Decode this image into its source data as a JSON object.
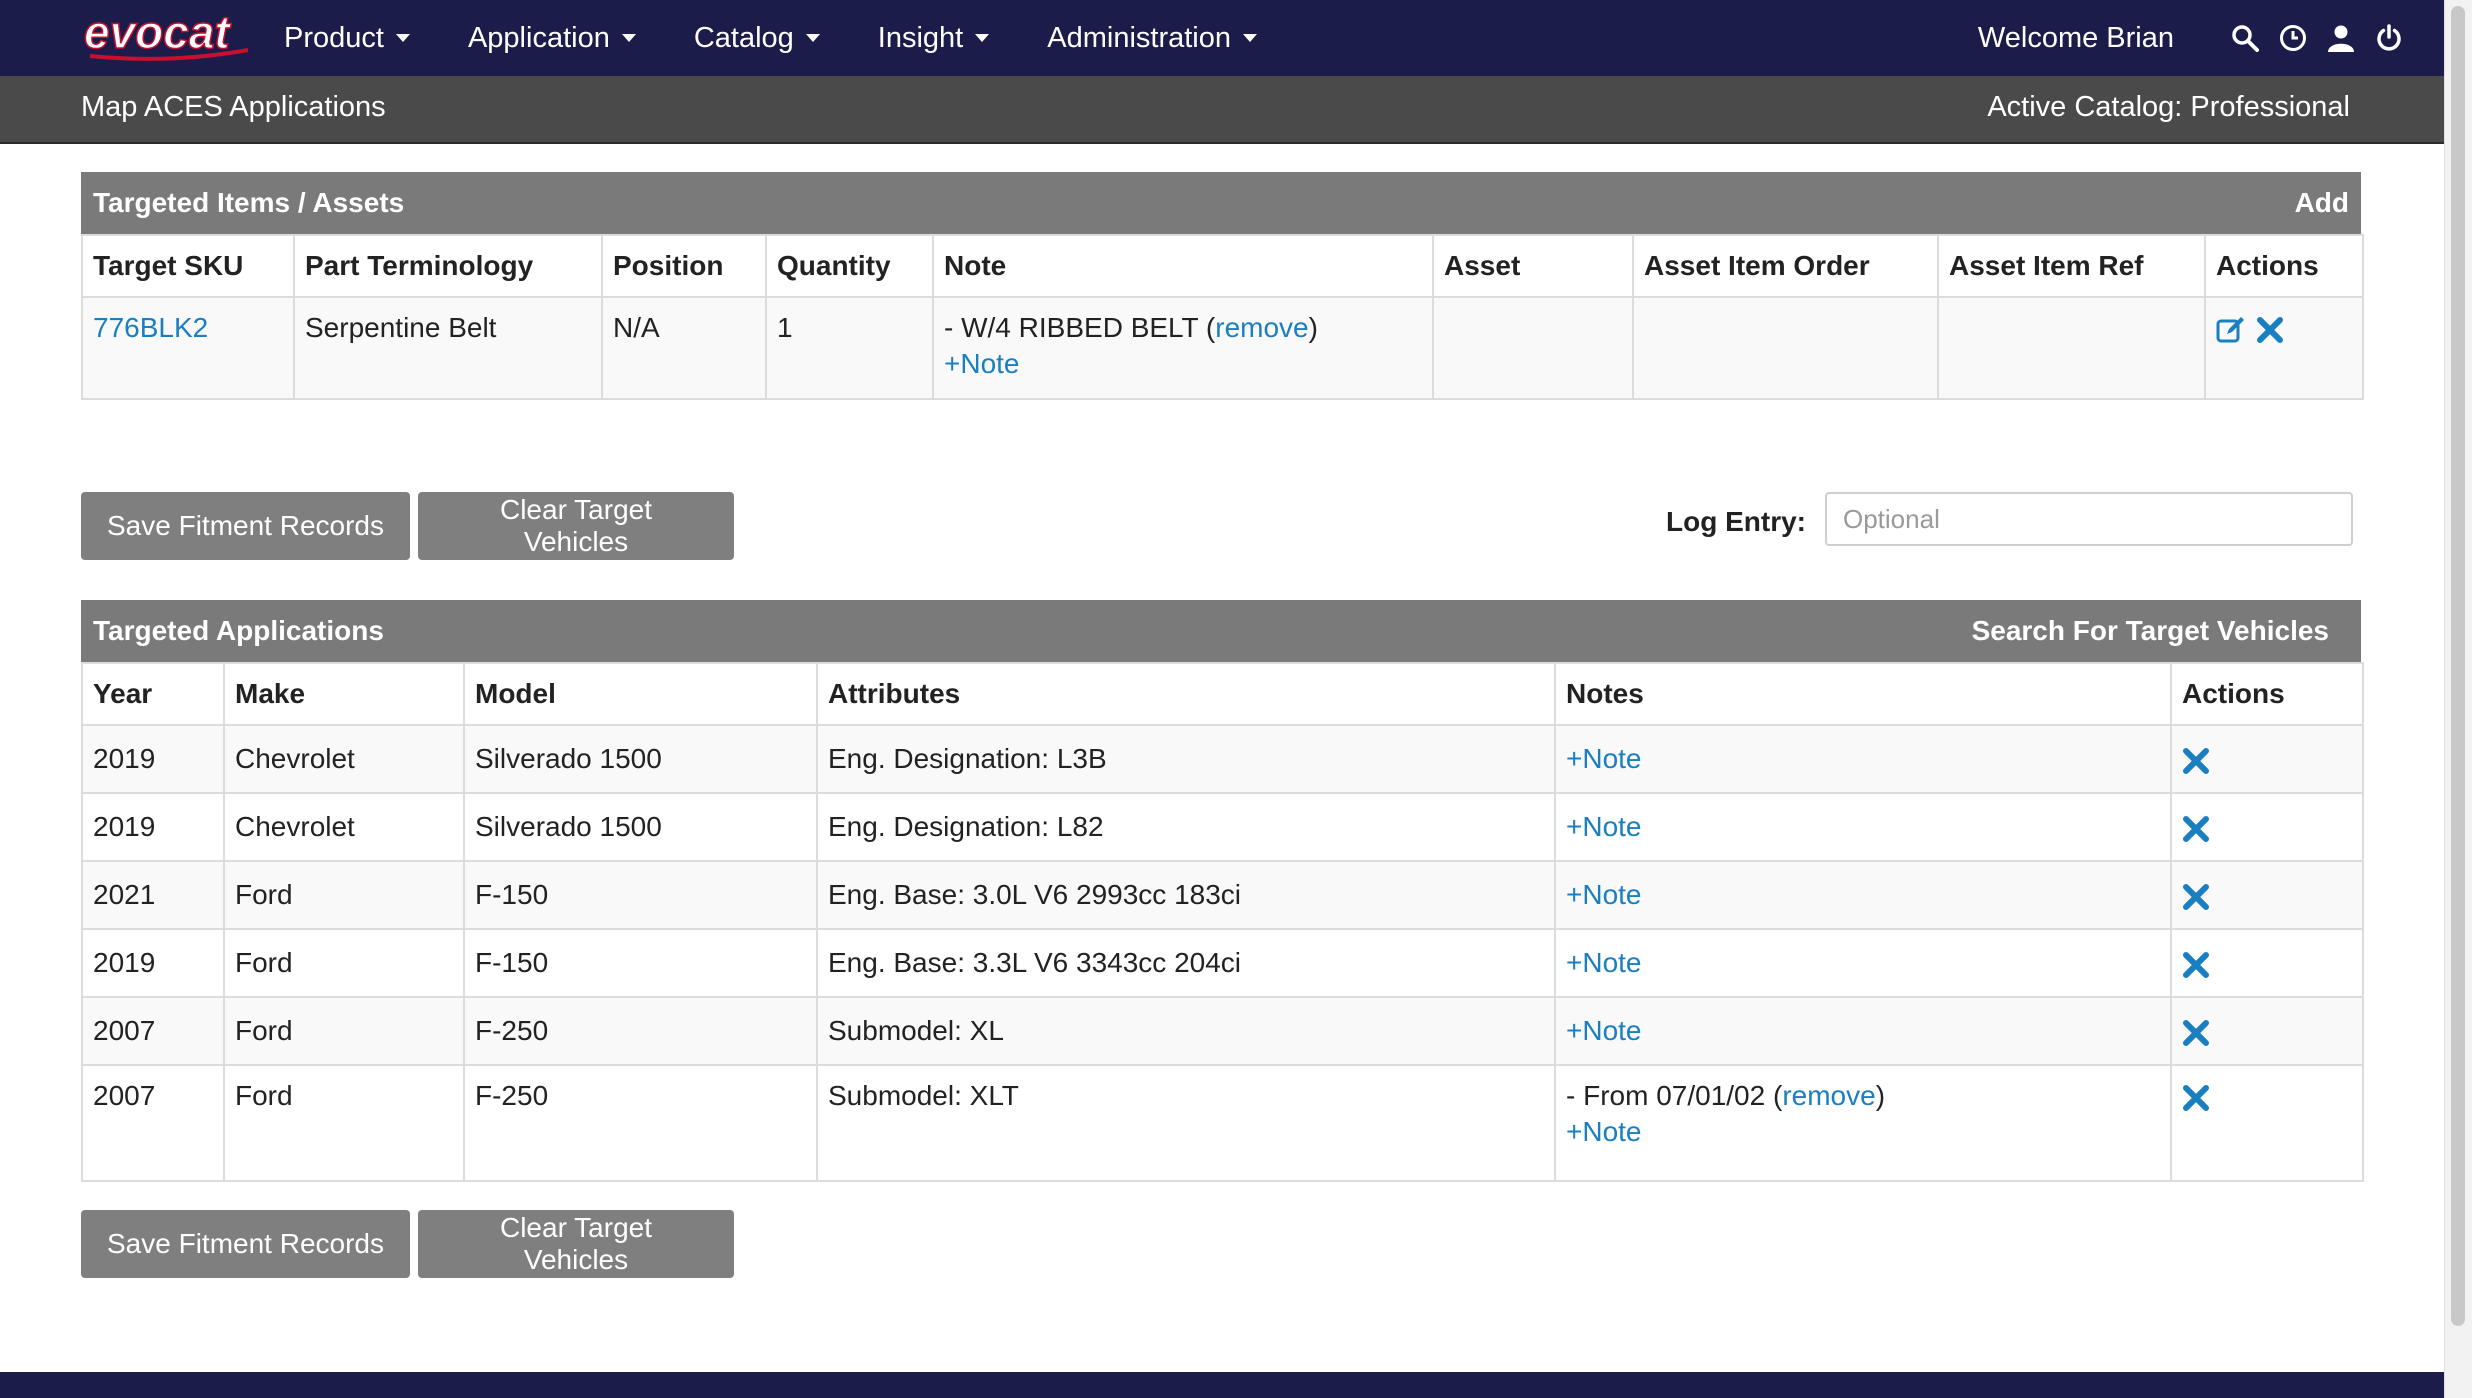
{
  "app": {
    "logo_text": "evocat"
  },
  "nav": {
    "items": [
      {
        "label": "Product"
      },
      {
        "label": "Application"
      },
      {
        "label": "Catalog"
      },
      {
        "label": "Insight"
      },
      {
        "label": "Administration"
      }
    ],
    "welcome": "Welcome Brian",
    "icons": [
      "search-icon",
      "history-icon",
      "user-icon",
      "power-icon"
    ]
  },
  "subheader": {
    "title": "Map ACES Applications",
    "active_catalog": "Active Catalog: Professional"
  },
  "items_panel": {
    "title": "Targeted Items / Assets",
    "action": "Add",
    "columns": [
      "Target SKU",
      "Part Terminology",
      "Position",
      "Quantity",
      "Note",
      "Asset",
      "Asset Item Order",
      "Asset Item Ref",
      "Actions"
    ],
    "rows": [
      {
        "sku": "776BLK2",
        "terminology": "Serpentine Belt",
        "position": "N/A",
        "quantity": "1",
        "note_prefix": "- W/4 RIBBED BELT (",
        "note_remove": "remove",
        "note_suffix": ")",
        "add_note": "+Note",
        "asset": "",
        "asset_item_order": "",
        "asset_item_ref": ""
      }
    ]
  },
  "buttons": {
    "save": "Save Fitment Records",
    "clear": "Clear Target Vehicles"
  },
  "log": {
    "label": "Log Entry:",
    "placeholder": "Optional",
    "value": ""
  },
  "apps_panel": {
    "title": "Targeted Applications",
    "action": "Search For Target Vehicles",
    "columns": [
      "Year",
      "Make",
      "Model",
      "Attributes",
      "Notes",
      "Actions"
    ],
    "rows": [
      {
        "year": "2019",
        "make": "Chevrolet",
        "model": "Silverado 1500",
        "attributes": "Eng. Designation: L3B",
        "note": "",
        "add_note": "+Note"
      },
      {
        "year": "2019",
        "make": "Chevrolet",
        "model": "Silverado 1500",
        "attributes": "Eng. Designation: L82",
        "note": "",
        "add_note": "+Note"
      },
      {
        "year": "2021",
        "make": "Ford",
        "model": "F-150",
        "attributes": "Eng. Base: 3.0L V6 2993cc 183ci",
        "note": "",
        "add_note": "+Note"
      },
      {
        "year": "2019",
        "make": "Ford",
        "model": "F-150",
        "attributes": "Eng. Base: 3.3L V6 3343cc 204ci",
        "note": "",
        "add_note": "+Note"
      },
      {
        "year": "2007",
        "make": "Ford",
        "model": "F-250",
        "attributes": "Submodel: XL",
        "note": "",
        "add_note": "+Note"
      },
      {
        "year": "2007",
        "make": "Ford",
        "model": "F-250",
        "attributes": "Submodel: XLT",
        "note_prefix": "- From 07/01/02 (",
        "note_remove": "remove",
        "note_suffix": ")",
        "add_note": "+Note"
      }
    ]
  },
  "colors": {
    "navbar": "#1c1c4a",
    "subheader": "#4a4a4a",
    "panel_header": "#7a7a7a",
    "button": "#7f7f7f",
    "link": "#1a7fc1"
  }
}
